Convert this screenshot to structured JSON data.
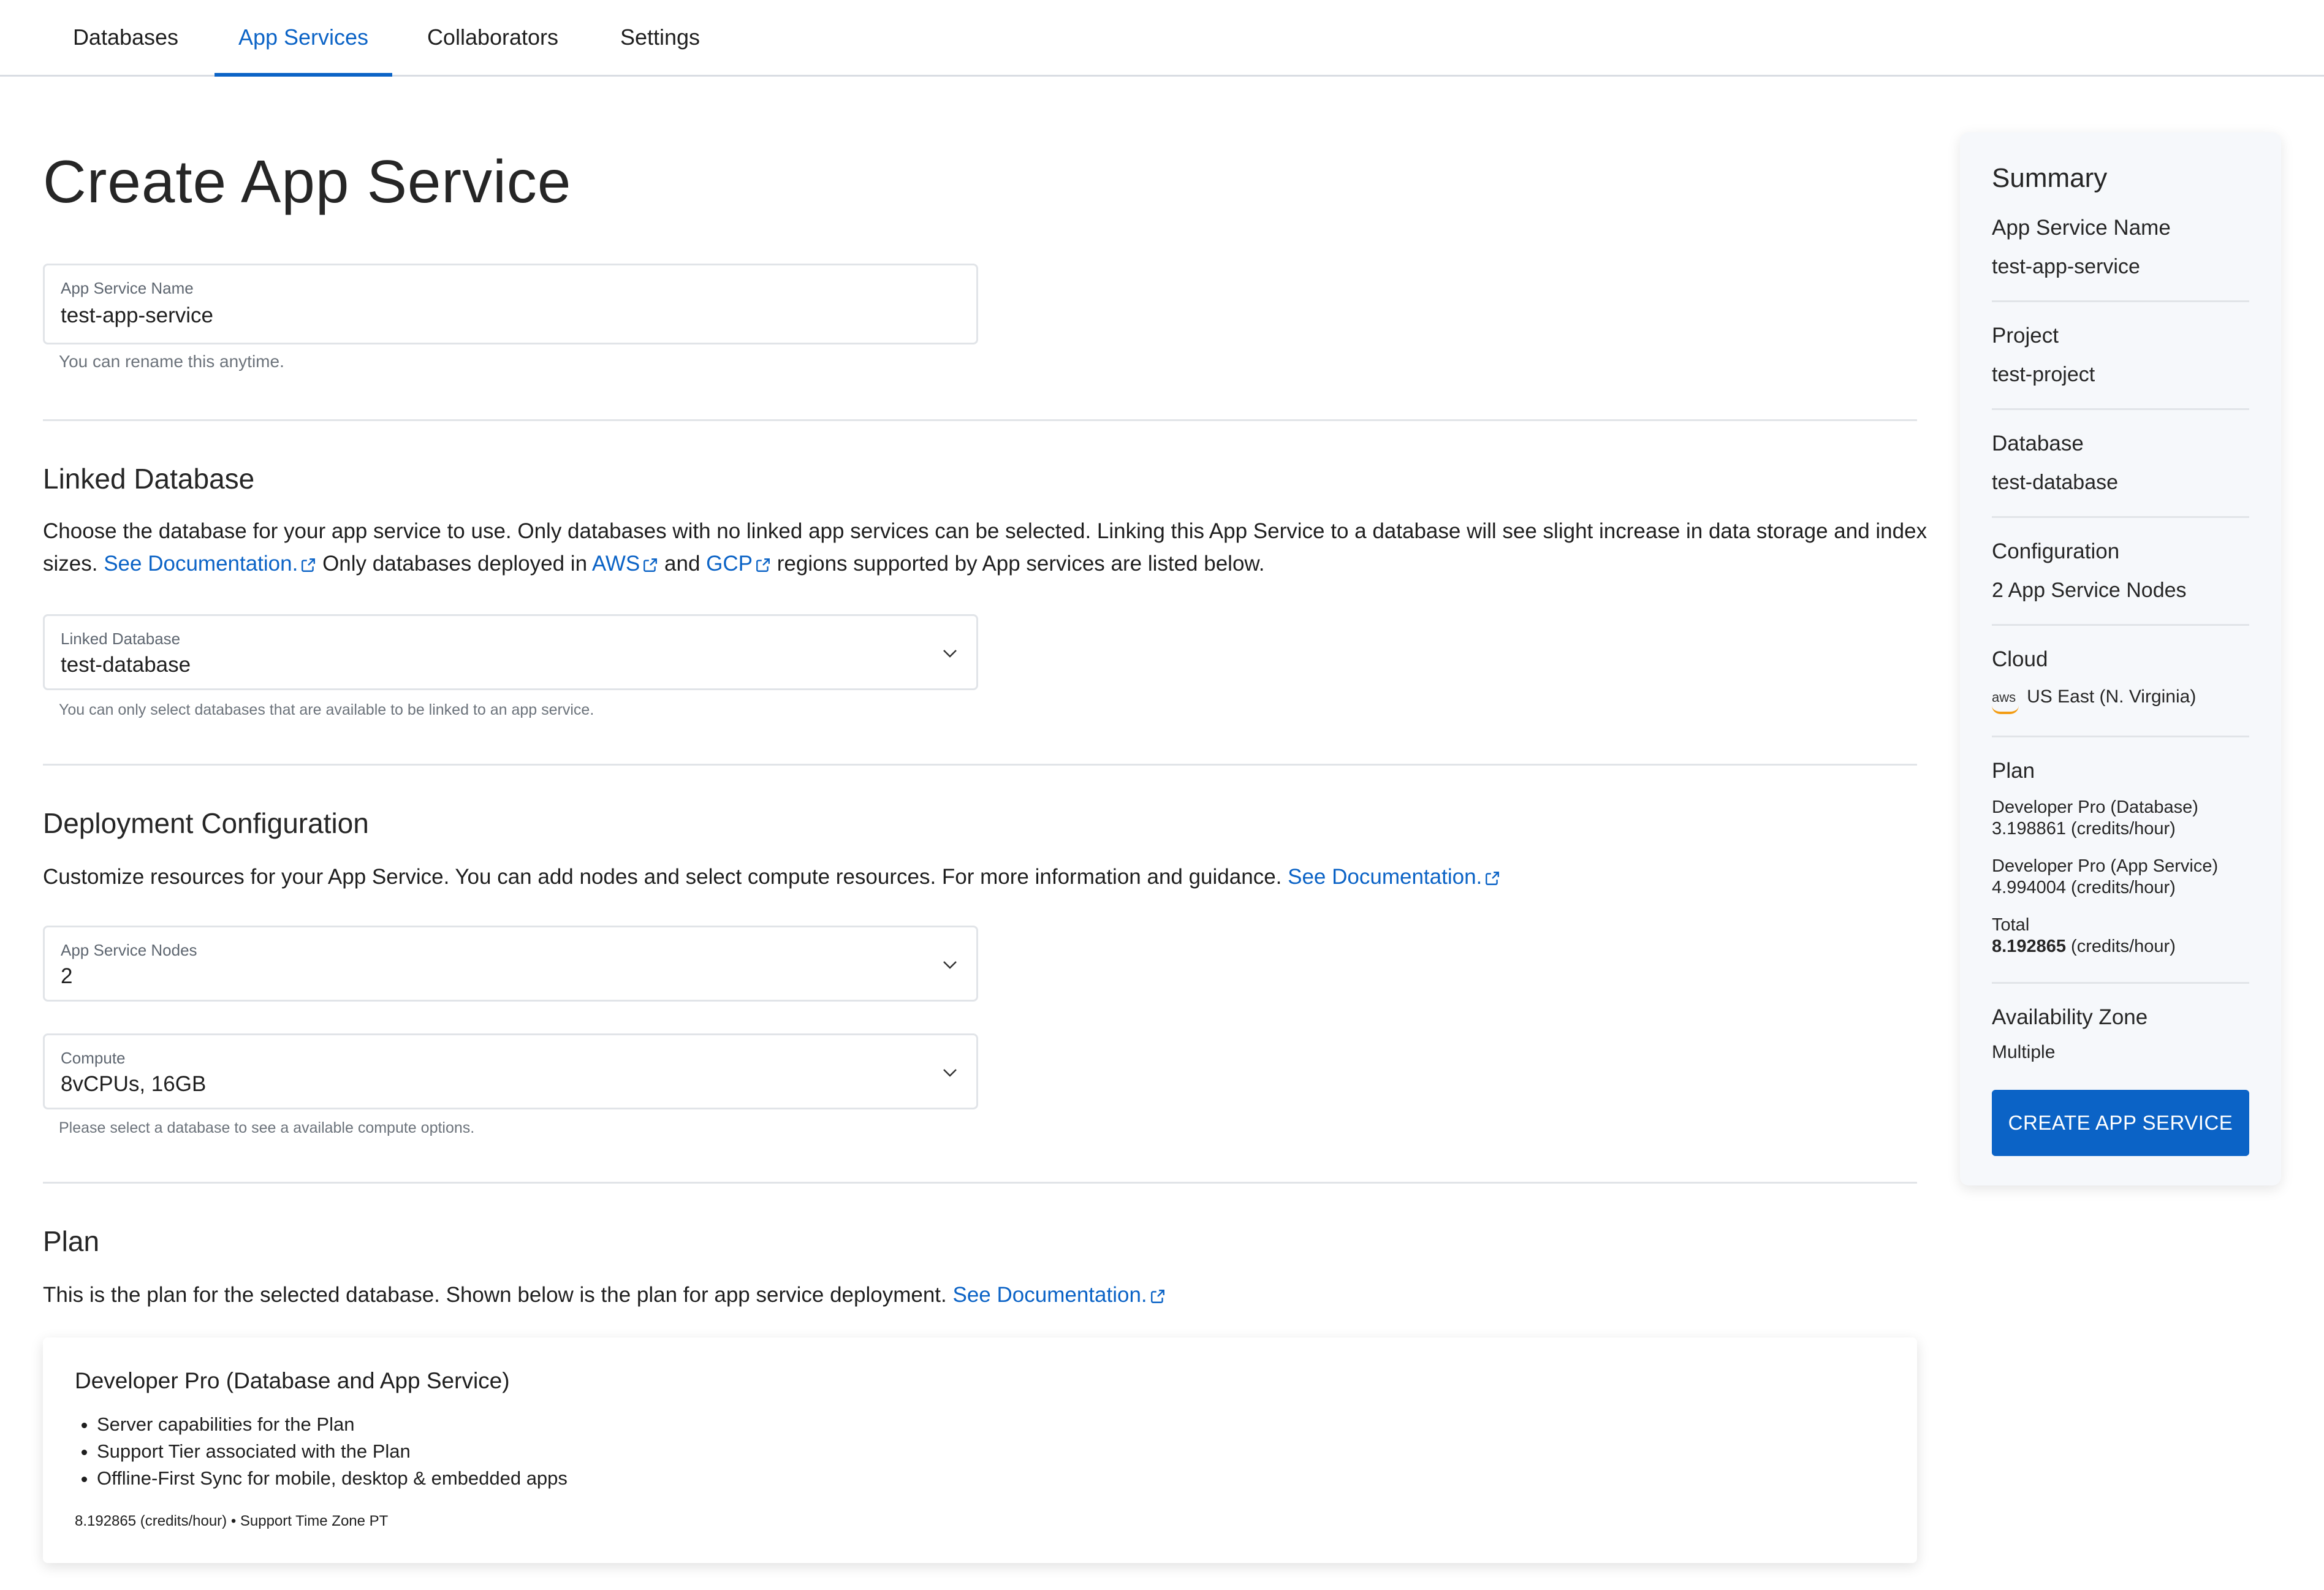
{
  "nav": {
    "tabs": [
      {
        "label": "Databases"
      },
      {
        "label": "App Services"
      },
      {
        "label": "Collaborators"
      },
      {
        "label": "Settings"
      }
    ],
    "active": "App Services"
  },
  "page": {
    "title": "Create App Service"
  },
  "name_field": {
    "label": "App Service Name",
    "value": "test-app-service",
    "help": "You can rename this anytime."
  },
  "linked_db": {
    "heading": "Linked Database",
    "desc_part1": "Choose the database for your app service to use. Only databases with no linked app services can be selected. Linking this App Service to a database will see slight increase in data storage and index sizes.",
    "doc_link": "See Documentation.",
    "desc_part2": "Only databases deployed in",
    "aws_link": "AWS",
    "and_text": "and",
    "gcp_link": "GCP",
    "desc_part3": "regions supported by App services are listed below.",
    "field_label": "Linked Database",
    "field_value": "test-database",
    "help": "You can only select databases that are available to be linked to an app service."
  },
  "deployment": {
    "heading": "Deployment Configuration",
    "desc": "Customize resources for your App Service. You can add nodes and select compute resources. For more information and guidance.",
    "doc_link": "See Documentation.",
    "nodes_label": "App Service Nodes",
    "nodes_value": "2",
    "compute_label": "Compute",
    "compute_value": "8vCPUs, 16GB",
    "compute_help": "Please select a database to see a available compute options."
  },
  "plan": {
    "heading": "Plan",
    "desc": "This is the plan for the selected database. Shown below is the plan for app service deployment.",
    "doc_link": "See Documentation.",
    "card_title": "Developer Pro (Database and App Service)",
    "bullets": [
      "Server capabilities for the Plan",
      "Support Tier associated with the Plan",
      "Offline-First Sync for mobile, desktop & embedded apps"
    ],
    "footer": "8.192865 (credits/hour) • Support Time Zone PT"
  },
  "summary": {
    "title": "Summary",
    "app_service_name_label": "App Service Name",
    "app_service_name": "test-app-service",
    "project_label": "Project",
    "project": "test-project",
    "database_label": "Database",
    "database": "test-database",
    "configuration_label": "Configuration",
    "configuration": "2 App Service Nodes",
    "cloud_label": "Cloud",
    "cloud_logo_text": "aws",
    "cloud": "US East (N. Virginia)",
    "plan_label": "Plan",
    "plan_db_name": "Developer Pro (Database)",
    "plan_db_rate": "3.198861 (credits/hour)",
    "plan_app_name": "Developer Pro (App Service)",
    "plan_app_rate": "4.994004 (credits/hour)",
    "total_label": "Total",
    "total_value": "8.192865",
    "total_unit": "(credits/hour)",
    "az_label": "Availability Zone",
    "az_value": "Multiple",
    "button": "CREATE APP SERVICE"
  },
  "colors": {
    "accent": "#0b63c6",
    "aws_orange": "#f39c12"
  }
}
